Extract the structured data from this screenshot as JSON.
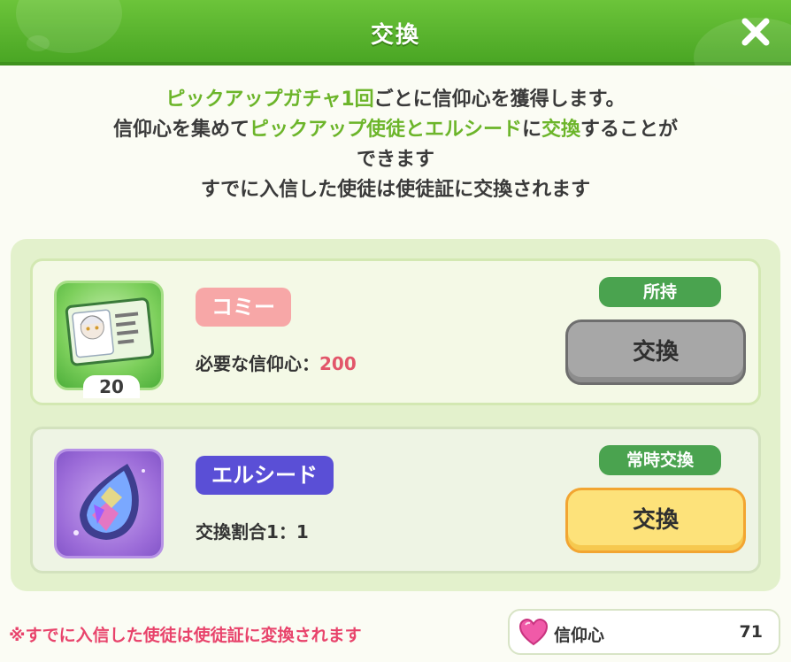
{
  "header": {
    "title": "交換"
  },
  "description": {
    "line1_hl": "ピックアップガチャ1回",
    "line1_rest": "ごとに信仰心を獲得します。",
    "line2_a": "信仰心を集めて",
    "line2_hl1": "ピックアップ使徒とエルシード",
    "line2_b": "に",
    "line2_hl2": "交換",
    "line2_c": "することが",
    "line3": "できます",
    "line4": "すでに入信した使徒は使徒証に交換されます"
  },
  "items": [
    {
      "name": "コミー",
      "count": "20",
      "requirement_label": "必要な信仰心：",
      "requirement_value": "200",
      "tag": "所持",
      "button": "交換",
      "card_text": "使徒証"
    },
    {
      "name": "エルシード",
      "requirement_label": "交換割合1：1",
      "tag": "常時交換",
      "button": "交換"
    }
  ],
  "footer": {
    "note": "※すでに入信した使徒は使徒証に変換されます",
    "currency_label": "信仰心",
    "currency_value": "71"
  },
  "icons": [
    "close-icon",
    "heart-icon",
    "crystal-icon",
    "card-icon"
  ],
  "colors": {
    "header": "#5bb52f",
    "accent_green": "#6cb52a",
    "pink_pill": "#f7a7a7",
    "purple_pill": "#5a4fd6",
    "yellow_button": "#fde27a",
    "gray_button": "#a7a7a7",
    "note_red": "#e8436b"
  }
}
